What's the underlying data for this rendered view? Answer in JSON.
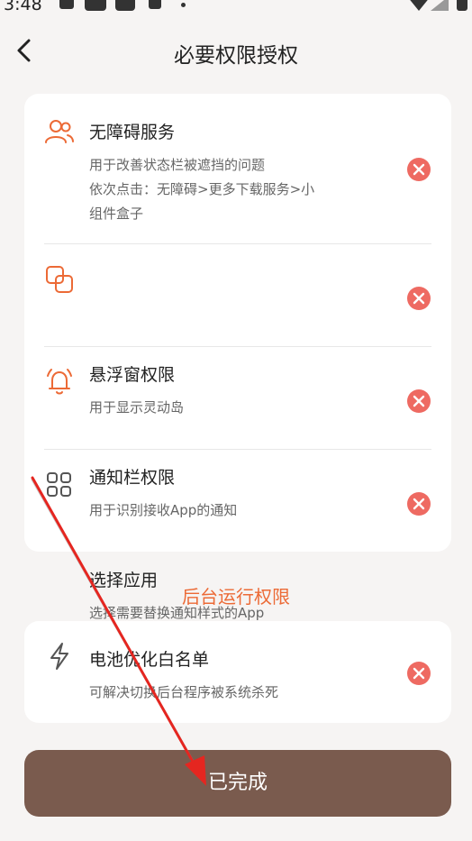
{
  "status_bar": {
    "time": "3:48"
  },
  "header": {
    "title": "必要权限授权"
  },
  "permissions": [
    {
      "title": "无障碍服务",
      "desc": "用于改善状态栏被遮挡的问题\n依次点击：无障碍>更多下载服务>小\n组件盒子",
      "icon": "users-icon"
    },
    {
      "title": "悬浮窗权限",
      "desc": "用于显示灵动岛",
      "icon": "overlay-window-icon"
    },
    {
      "title": "通知栏权限",
      "desc": "用于识别接收App的通知",
      "icon": "bell-icon"
    },
    {
      "title": "选择应用",
      "desc": "选择需要替换通知样式的App",
      "icon": "apps-grid-icon"
    }
  ],
  "background_section": {
    "title": "后台运行权限",
    "item": {
      "title": "电池优化白名单",
      "desc": "可解决切换后台程序被系统杀死",
      "icon": "lightning-icon"
    }
  },
  "done_button": {
    "label": "已完成"
  },
  "colors": {
    "accent": "#ec6a36",
    "button": "#7a5b4e",
    "delete": "#ee6a62",
    "background": "#f6f4f3"
  }
}
